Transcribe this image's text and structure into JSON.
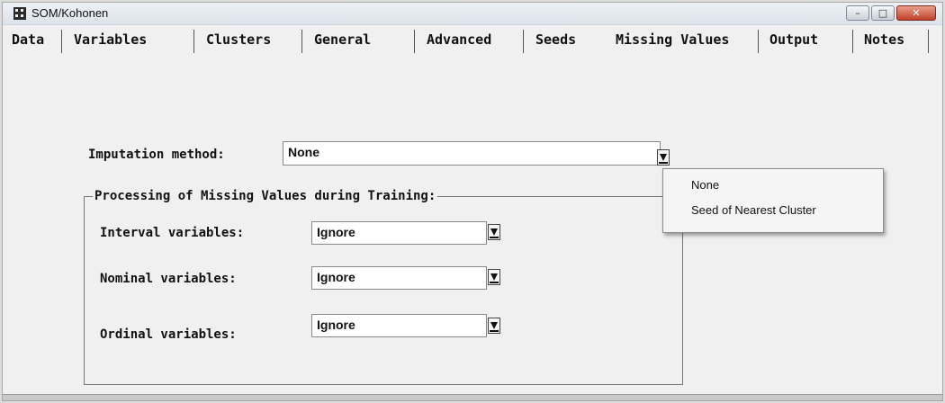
{
  "window": {
    "title": "SOM/Kohonen"
  },
  "tabs": [
    {
      "label": "Data"
    },
    {
      "label": "Variables"
    },
    {
      "label": "Clusters"
    },
    {
      "label": "General"
    },
    {
      "label": "Advanced"
    },
    {
      "label": "Seeds"
    },
    {
      "label": "Missing Values",
      "selected": true
    },
    {
      "label": "Output"
    },
    {
      "label": "Notes"
    }
  ],
  "imputation": {
    "label": "Imputation method:",
    "value": "None"
  },
  "processing": {
    "title": "Processing of Missing Values during Training:",
    "interval": {
      "label": "Interval variables:",
      "value": "Ignore"
    },
    "nominal": {
      "label": "Nominal variables:",
      "value": "Ignore"
    },
    "ordinal": {
      "label": "Ordinal variables:",
      "value": "Ignore"
    }
  },
  "dropdown": {
    "options": [
      "None",
      "Seed of Nearest Cluster"
    ]
  },
  "icons": {
    "app": "grid-app-icon",
    "minimize": "minimize-icon",
    "maximize": "maximize-icon",
    "close": "close-icon",
    "dropdown": "chevron-down-icon"
  }
}
